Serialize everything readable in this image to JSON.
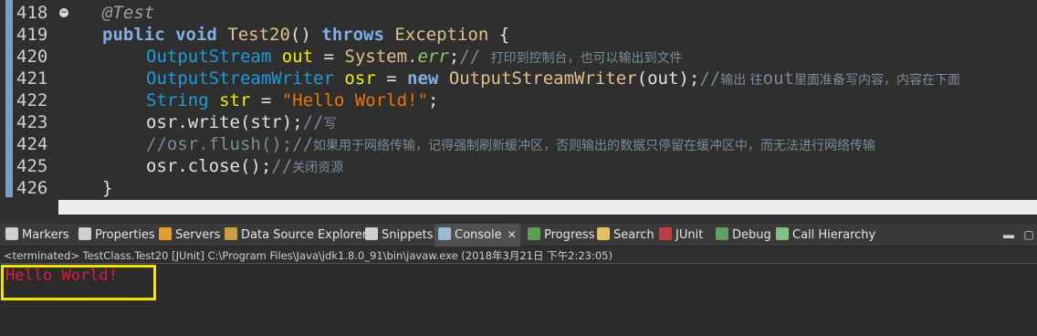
{
  "editor": {
    "lines": [
      {
        "num": "418",
        "fold": true,
        "parts": [
          {
            "c": "ann",
            "t": "@Test"
          }
        ],
        "indent": 1
      },
      {
        "num": "419",
        "parts": [
          {
            "c": "kw",
            "t": "public "
          },
          {
            "c": "kw",
            "t": "void "
          },
          {
            "c": "ex",
            "t": "Test20"
          },
          {
            "c": "txt",
            "t": "() "
          },
          {
            "c": "kw",
            "t": "throws "
          },
          {
            "c": "ex",
            "t": "Exception "
          },
          {
            "c": "txt",
            "t": "{"
          }
        ],
        "indent": 1
      },
      {
        "num": "420",
        "parts": [
          {
            "c": "type",
            "t": "OutputStream "
          },
          {
            "c": "var",
            "t": "out "
          },
          {
            "c": "txt",
            "t": "= "
          },
          {
            "c": "ex",
            "t": "System."
          },
          {
            "c": "fld",
            "t": "err"
          },
          {
            "c": "txt",
            "t": ";"
          },
          {
            "c": "cmt",
            "t": "// "
          },
          {
            "c": "cmtcn",
            "t": "打印到控制台，也可以输出到文件"
          }
        ],
        "indent": 2
      },
      {
        "num": "421",
        "parts": [
          {
            "c": "type",
            "t": "OutputStreamWriter "
          },
          {
            "c": "var",
            "t": "osr "
          },
          {
            "c": "txt",
            "t": "= "
          },
          {
            "c": "kw",
            "t": "new "
          },
          {
            "c": "ex",
            "t": "OutputStreamWriter"
          },
          {
            "c": "txt",
            "t": "(out);"
          },
          {
            "c": "cmt",
            "t": "//"
          },
          {
            "c": "cmtcn",
            "t": "输出 往"
          },
          {
            "c": "cmt",
            "t": "out"
          },
          {
            "c": "cmtcn",
            "t": "里面准备写内容，内容在下面"
          }
        ],
        "indent": 2
      },
      {
        "num": "422",
        "parts": [
          {
            "c": "type",
            "t": "String "
          },
          {
            "c": "var",
            "t": "str "
          },
          {
            "c": "txt",
            "t": "= "
          },
          {
            "c": "str",
            "t": "\"Hello World!\""
          },
          {
            "c": "txt",
            "t": ";"
          }
        ],
        "indent": 2
      },
      {
        "num": "423",
        "parts": [
          {
            "c": "txt",
            "t": "osr.write(str);"
          },
          {
            "c": "cmt",
            "t": "//"
          },
          {
            "c": "cmtcn",
            "t": "写"
          }
        ],
        "indent": 2
      },
      {
        "num": "424",
        "parts": [
          {
            "c": "cmt",
            "t": "//osr.flush();//"
          },
          {
            "c": "cmtcn",
            "t": "如果用于网络传输，记得强制刷新缓冲区，否则输出的数据只停留在缓冲区中，而无法进行网络传输"
          }
        ],
        "indent": 2
      },
      {
        "num": "425",
        "parts": [
          {
            "c": "txt",
            "t": "osr.close();"
          },
          {
            "c": "cmt",
            "t": "//"
          },
          {
            "c": "cmtcn",
            "t": "关闭资源"
          }
        ],
        "indent": 2
      },
      {
        "num": "426",
        "parts": [
          {
            "c": "txt",
            "t": "}"
          }
        ],
        "indent": 1
      }
    ]
  },
  "tabs": [
    {
      "label": "Markers",
      "icon": "markers-icon",
      "color": "#d0d0d0"
    },
    {
      "label": "Properties",
      "icon": "properties-icon",
      "color": "#d0d0d0"
    },
    {
      "label": "Servers",
      "icon": "servers-icon",
      "color": "#e0a030"
    },
    {
      "label": "Data Source Explorer",
      "icon": "data-source-icon",
      "color": "#c8a040"
    },
    {
      "label": "Snippets",
      "icon": "snippets-icon",
      "color": "#d0d0d0"
    },
    {
      "label": "Console",
      "icon": "console-icon",
      "color": "#9ab8d8",
      "active": true,
      "close": "✕"
    },
    {
      "label": "Progress",
      "icon": "progress-icon",
      "color": "#5aa050"
    },
    {
      "label": "Search",
      "icon": "search-icon",
      "color": "#e0c060"
    },
    {
      "label": "JUnit",
      "icon": "junit-icon",
      "color": "#c04040"
    },
    {
      "label": "Debug",
      "icon": "debug-icon",
      "color": "#60a060"
    },
    {
      "label": "Call Hierarchy",
      "icon": "call-hierarchy-icon",
      "color": "#80c080"
    }
  ],
  "console": {
    "header": "<terminated> TestClass.Test20 [JUnit] C:\\Program Files\\Java\\jdk1.8.0_91\\bin\\javaw.exe (2018年3月21日 下午2:23:05)",
    "output": "Hello World!"
  },
  "colors": {
    "highlight_box": "#f0e400",
    "output_text": "#dc1e3c"
  }
}
